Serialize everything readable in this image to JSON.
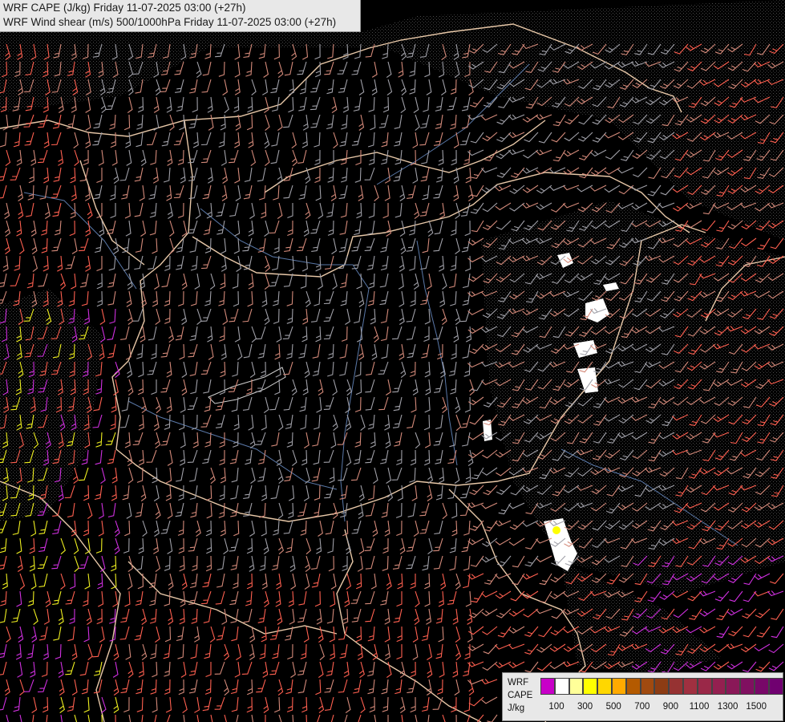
{
  "title": {
    "line1": "WRF CAPE (J/kg) Friday 11-07-2025 03:00 (+27h)",
    "line2": "WRF Wind shear (m/s) 500/1000hPa Friday 11-07-2025 03:00 (+27h)"
  },
  "legend": {
    "label_lines": [
      "WRF",
      "CAPE",
      "J/kg"
    ],
    "swatch_colors": [
      "#c800c8",
      "#ffffff",
      "#ffff99",
      "#ffff00",
      "#ffd700",
      "#ffaa00",
      "#b45a00",
      "#a04a10",
      "#8c3c14",
      "#963232",
      "#a03040",
      "#9a2848",
      "#942050",
      "#8a1858",
      "#801060",
      "#780868",
      "#700070"
    ],
    "tick_labels": [
      "100",
      "300",
      "500",
      "700",
      "900",
      "1100",
      "1300",
      "1500"
    ]
  },
  "colors": {
    "background": "#000000",
    "borders": "#e8c8a8",
    "rivers": "#5a78a8",
    "shear_low": "#a0a0a8",
    "shear_mid": "#d48a7a",
    "shear_high": "#ff6050",
    "shear_magenta": "#d030e0",
    "shear_yellow": "#f0f020"
  }
}
